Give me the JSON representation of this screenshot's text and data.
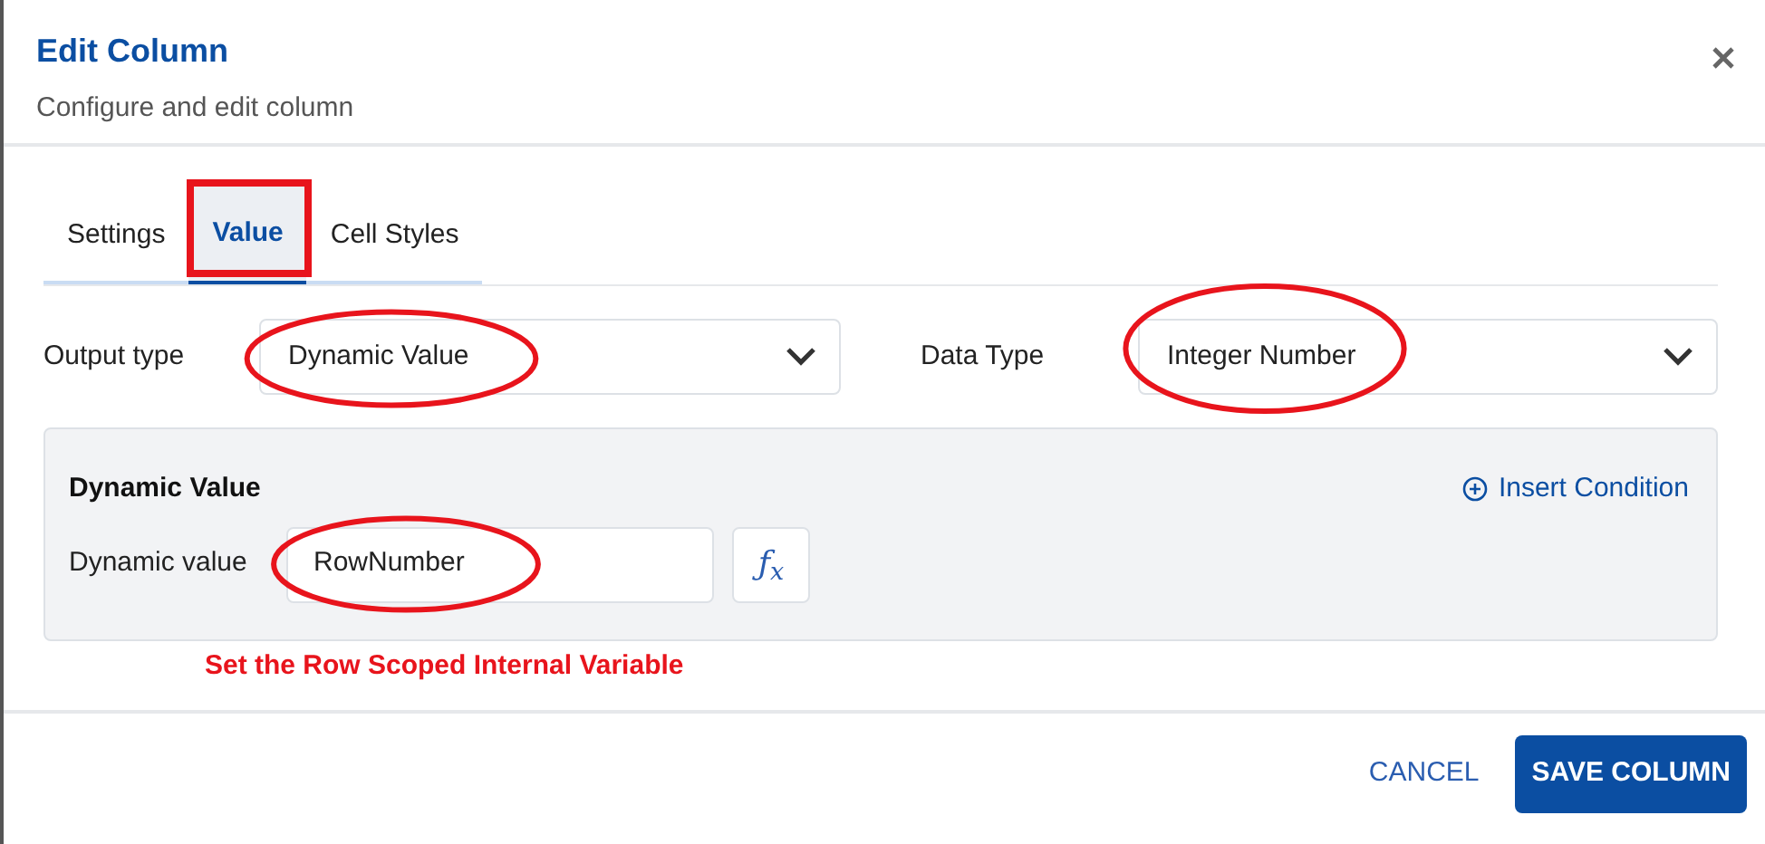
{
  "dialog": {
    "title": "Edit Column",
    "subtitle": "Configure and edit column"
  },
  "tabs": [
    {
      "label": "Settings",
      "selected": false,
      "highlighted": false
    },
    {
      "label": "Value",
      "selected": true,
      "highlighted": true
    },
    {
      "label": "Cell Styles",
      "selected": false,
      "highlighted": false
    }
  ],
  "fields": [
    {
      "label": "Output type",
      "value": "Dynamic Value",
      "highlighted": true
    },
    {
      "label": "Data Type",
      "value": "Integer Number",
      "highlighted": true
    }
  ],
  "dynamic_panel": {
    "title": "Dynamic Value",
    "insert_condition": "Insert Condition",
    "field": {
      "label": "Dynamic value",
      "value": "RowNumber",
      "highlighted": true
    },
    "formula_button": "ƒ$_{x}$"
  },
  "annotation": "Set the Row Scoped Internal Variable",
  "buttons": [
    {
      "label": "CANCEL",
      "kind": "text"
    },
    {
      "label": "SAVE COLUMN",
      "kind": "primary"
    }
  ]
}
